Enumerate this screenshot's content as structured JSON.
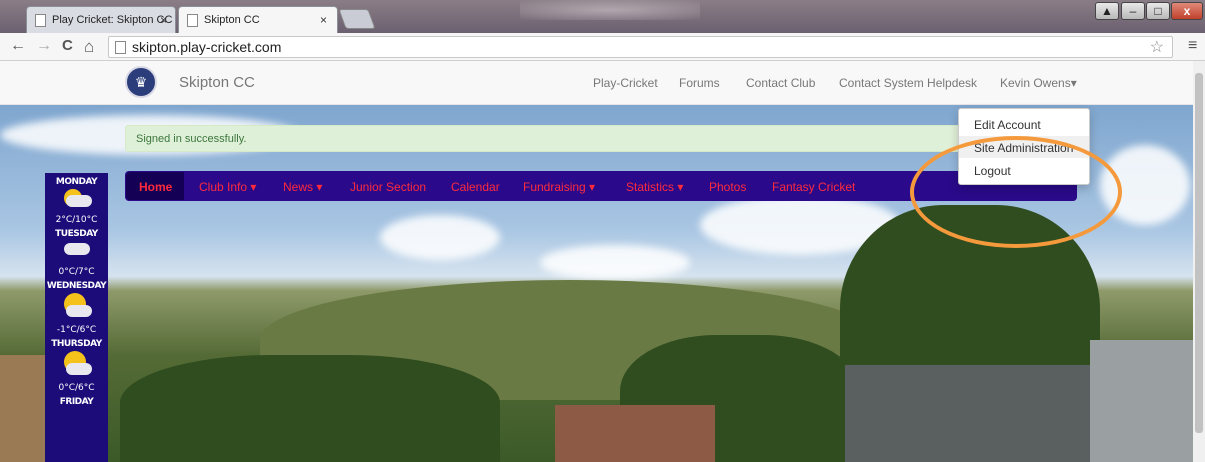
{
  "browser": {
    "tabs": [
      {
        "title": "Play Cricket: Skipton CC"
      },
      {
        "title": "Skipton CC"
      }
    ],
    "close_glyph": "×",
    "url": "skipton.play-cricket.com",
    "back_icon": "←",
    "forward_icon": "→",
    "reload_icon": "C",
    "home_icon": "⌂",
    "star_icon": "☆",
    "menu_icon": "≡",
    "window_controls": {
      "minimize": "–",
      "maximize": "□",
      "close": "x",
      "extra": "▲"
    }
  },
  "site": {
    "brand": "Skipton CC",
    "logo_glyph": "♛",
    "top_nav": [
      "Play-Cricket",
      "Forums",
      "Contact Club",
      "Contact System Helpdesk"
    ],
    "user_menu": "Kevin Owens▾",
    "alert": "Signed in successfully.",
    "main_nav": [
      "Home",
      "Club Info ▾",
      "News ▾",
      "Junior Section",
      "Calendar",
      "Fundraising ▾",
      "Statistics ▾",
      "Photos",
      "Fantasy Cricket"
    ],
    "dropdown": [
      "Edit Account",
      "Site Administration",
      "Logout"
    ],
    "weather": [
      {
        "day": "MONDAY",
        "temp": "2°C/10°C"
      },
      {
        "day": "TUESDAY",
        "temp": "0°C/7°C"
      },
      {
        "day": "WEDNESDAY",
        "temp": "-1°C/6°C"
      },
      {
        "day": "THURSDAY",
        "temp": "0°C/6°C"
      },
      {
        "day": "FRIDAY",
        "temp": ""
      }
    ]
  },
  "colors": {
    "nav_bg": "#2a0a8a",
    "nav_text": "#ff2a3c",
    "alert_bg": "#dff0d8",
    "highlight_ring": "#f49a3c"
  }
}
